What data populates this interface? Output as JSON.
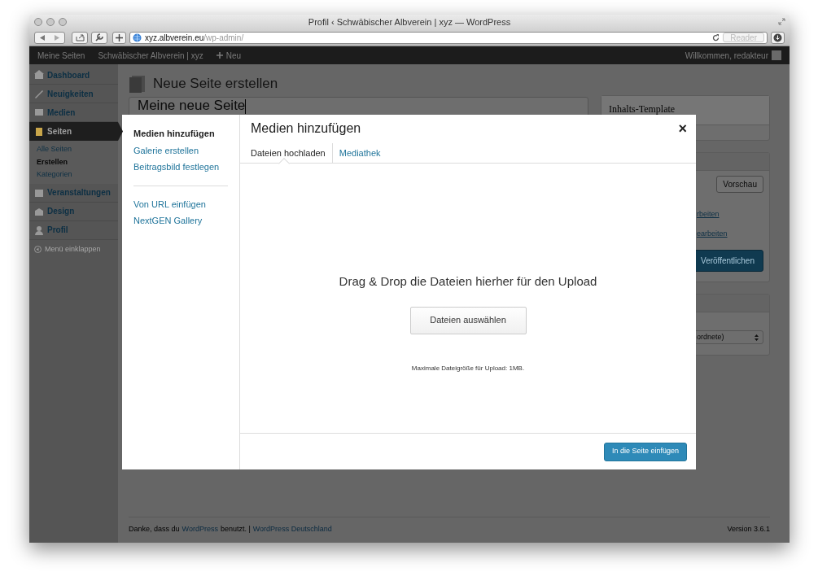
{
  "browser": {
    "title": "Profil ‹ Schwäbischer Albverein | xyz — WordPress",
    "url_domain": "xyz.albverein.eu",
    "url_path": "/wp-admin/",
    "reader": {
      "label": "Reader",
      "disabled": true
    }
  },
  "admin_bar": {
    "items": [
      {
        "label": "Meine Seiten",
        "kind": "text"
      },
      {
        "label": "Schwäbischer Albverein | xyz",
        "kind": "text"
      },
      {
        "label": "Neu",
        "kind": "new"
      }
    ],
    "greeting": "Willkommen, redakteur"
  },
  "sidebar": {
    "items": [
      {
        "label": "Dashboard",
        "selected": false
      },
      {
        "label": "Neuigkeiten",
        "selected": false
      },
      {
        "label": "Medien",
        "selected": false
      },
      {
        "label": "Seiten",
        "selected": true,
        "children": [
          {
            "label": "Alle Seiten",
            "selected": false
          },
          {
            "label": "Erstellen",
            "selected": true
          },
          {
            "label": "Kategorien",
            "selected": false
          }
        ]
      },
      {
        "label": "Veranstaltungen",
        "selected": false
      },
      {
        "label": "Design",
        "selected": false
      },
      {
        "label": "Profil",
        "selected": false
      }
    ],
    "collapse": "Menü einklappen"
  },
  "page": {
    "heading": "Neue Seite erstellen",
    "title_value": "Meine neue Seite",
    "template_box": {
      "title": "Inhalts-Template"
    },
    "publish_box": {
      "preview": "Vorschau",
      "links": [
        "rbeiten",
        "earbeiten"
      ],
      "publish": "Veröffentlichen"
    },
    "attributes_box": {
      "select": "ordnete)"
    }
  },
  "footer": {
    "thanks": [
      {
        "text": "Danke, dass du",
        "kind": "text"
      },
      {
        "text": "WordPress",
        "kind": "link"
      },
      {
        "text": "benutzt. |",
        "kind": "text"
      },
      {
        "text": "WordPress Deutschland",
        "kind": "link"
      }
    ],
    "version": "Version 3.6.1"
  },
  "modal": {
    "menu_groups": [
      [
        {
          "label": "Medien hinzufügen",
          "selected": true
        },
        {
          "label": "Galerie erstellen",
          "selected": false
        },
        {
          "label": "Beitragsbild festlegen",
          "selected": false
        }
      ],
      [
        {
          "label": "Von URL einfügen",
          "selected": false
        },
        {
          "label": "NextGEN Gallery",
          "selected": false
        }
      ]
    ],
    "title": "Medien hinzufügen",
    "close": "×",
    "tabs": [
      {
        "label": "Dateien hochladen",
        "selected": true
      },
      {
        "label": "Mediathek",
        "selected": false
      }
    ],
    "drop_text": "Drag & Drop die Dateien hierher für den Upload",
    "select_button": "Dateien auswählen",
    "max_size": "Maximale Dateigröße für Upload: 1MB.",
    "insert_button": "In die Seite einfügen"
  }
}
